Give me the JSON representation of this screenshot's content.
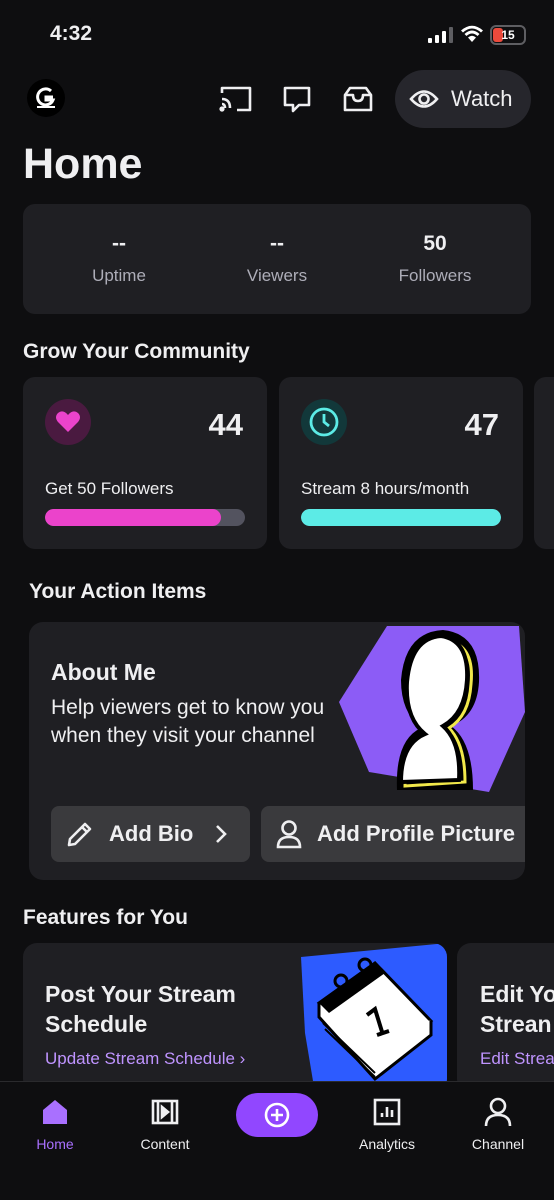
{
  "status_bar": {
    "time": "4:32",
    "battery": "15"
  },
  "header": {
    "watch_label": "Watch",
    "icons": [
      "cast-icon",
      "chat-bubble-icon",
      "inbox-icon",
      "eye-icon"
    ]
  },
  "page": {
    "title": "Home"
  },
  "stats": [
    {
      "value": "--",
      "label": "Uptime"
    },
    {
      "value": "--",
      "label": "Viewers"
    },
    {
      "value": "50",
      "label": "Followers"
    }
  ],
  "grow": {
    "title": "Grow Your Community",
    "goals": [
      {
        "value": "44",
        "label": "Get 50 Followers",
        "progress": 0.88,
        "color": "#eb43cb",
        "icon": "heart-icon"
      },
      {
        "value": "47",
        "label": "Stream 8 hours/month",
        "progress": 1.0,
        "color": "#5cebe6",
        "icon": "clock-icon"
      }
    ]
  },
  "action_items": {
    "title": "Your Action Items",
    "about": {
      "title": "About Me",
      "description": "Help viewers get to know you when they visit your channel",
      "add_bio": "Add Bio",
      "add_picture": "Add Profile Picture"
    }
  },
  "features": {
    "title": "Features for You",
    "cards": [
      {
        "title": "Post Your Stream Schedule",
        "link": "Update Stream Schedule ›"
      },
      {
        "title": "Edit Yo Strean",
        "link": "Edit Strea"
      }
    ]
  },
  "tabs": [
    {
      "label": "Home",
      "active": true
    },
    {
      "label": "Content",
      "active": false
    },
    {
      "label": "Analytics",
      "active": false
    },
    {
      "label": "Channel",
      "active": false
    }
  ],
  "colors": {
    "accent": "#9147ff",
    "accent_text": "#a970ff",
    "card": "#1f1f23",
    "background": "#0e0e10"
  }
}
